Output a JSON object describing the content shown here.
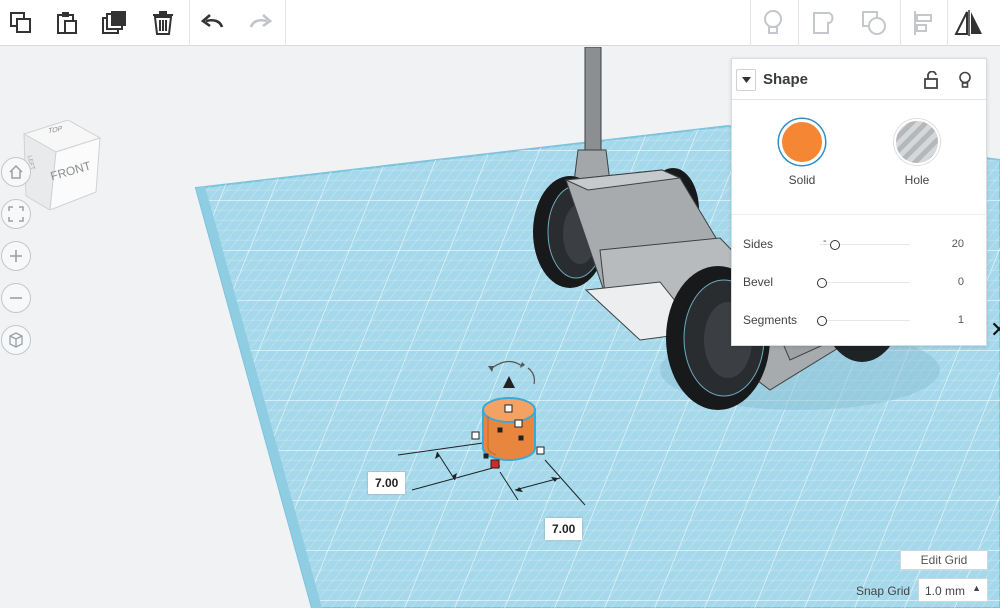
{
  "toolbar": {
    "left_tools": [
      "copy-icon",
      "paste-icon",
      "duplicate-icon",
      "delete-icon",
      "undo-icon",
      "redo-icon"
    ],
    "right_tools": [
      "lightbulb-icon",
      "group-icon",
      "ungroup-icon",
      "align-icon",
      "mirror-icon"
    ]
  },
  "viewcube": {
    "top_face": "TOP",
    "front_face": "FRONT",
    "side_face": "LEFT"
  },
  "nav_controls": [
    "home-view-icon",
    "fit-view-icon",
    "zoom-in-icon",
    "zoom-out-icon",
    "perspective-icon"
  ],
  "dimensions": {
    "width": "7.00",
    "length": "7.00"
  },
  "shape_panel": {
    "title": "Shape",
    "solid_label": "Solid",
    "hole_label": "Hole",
    "solid_color": "#f48634",
    "properties": [
      {
        "label": "Sides",
        "value": "20"
      },
      {
        "label": "Bevel",
        "value": "0"
      },
      {
        "label": "Segments",
        "value": "1"
      }
    ]
  },
  "grid_controls": {
    "edit_grid_label": "Edit Grid",
    "snap_grid_label": "Snap Grid",
    "snap_grid_value": "1.0 mm"
  },
  "colors": {
    "workplane": "#a5d8ea",
    "accent": "#3aa9d6",
    "cylinder": "#e8853e"
  }
}
